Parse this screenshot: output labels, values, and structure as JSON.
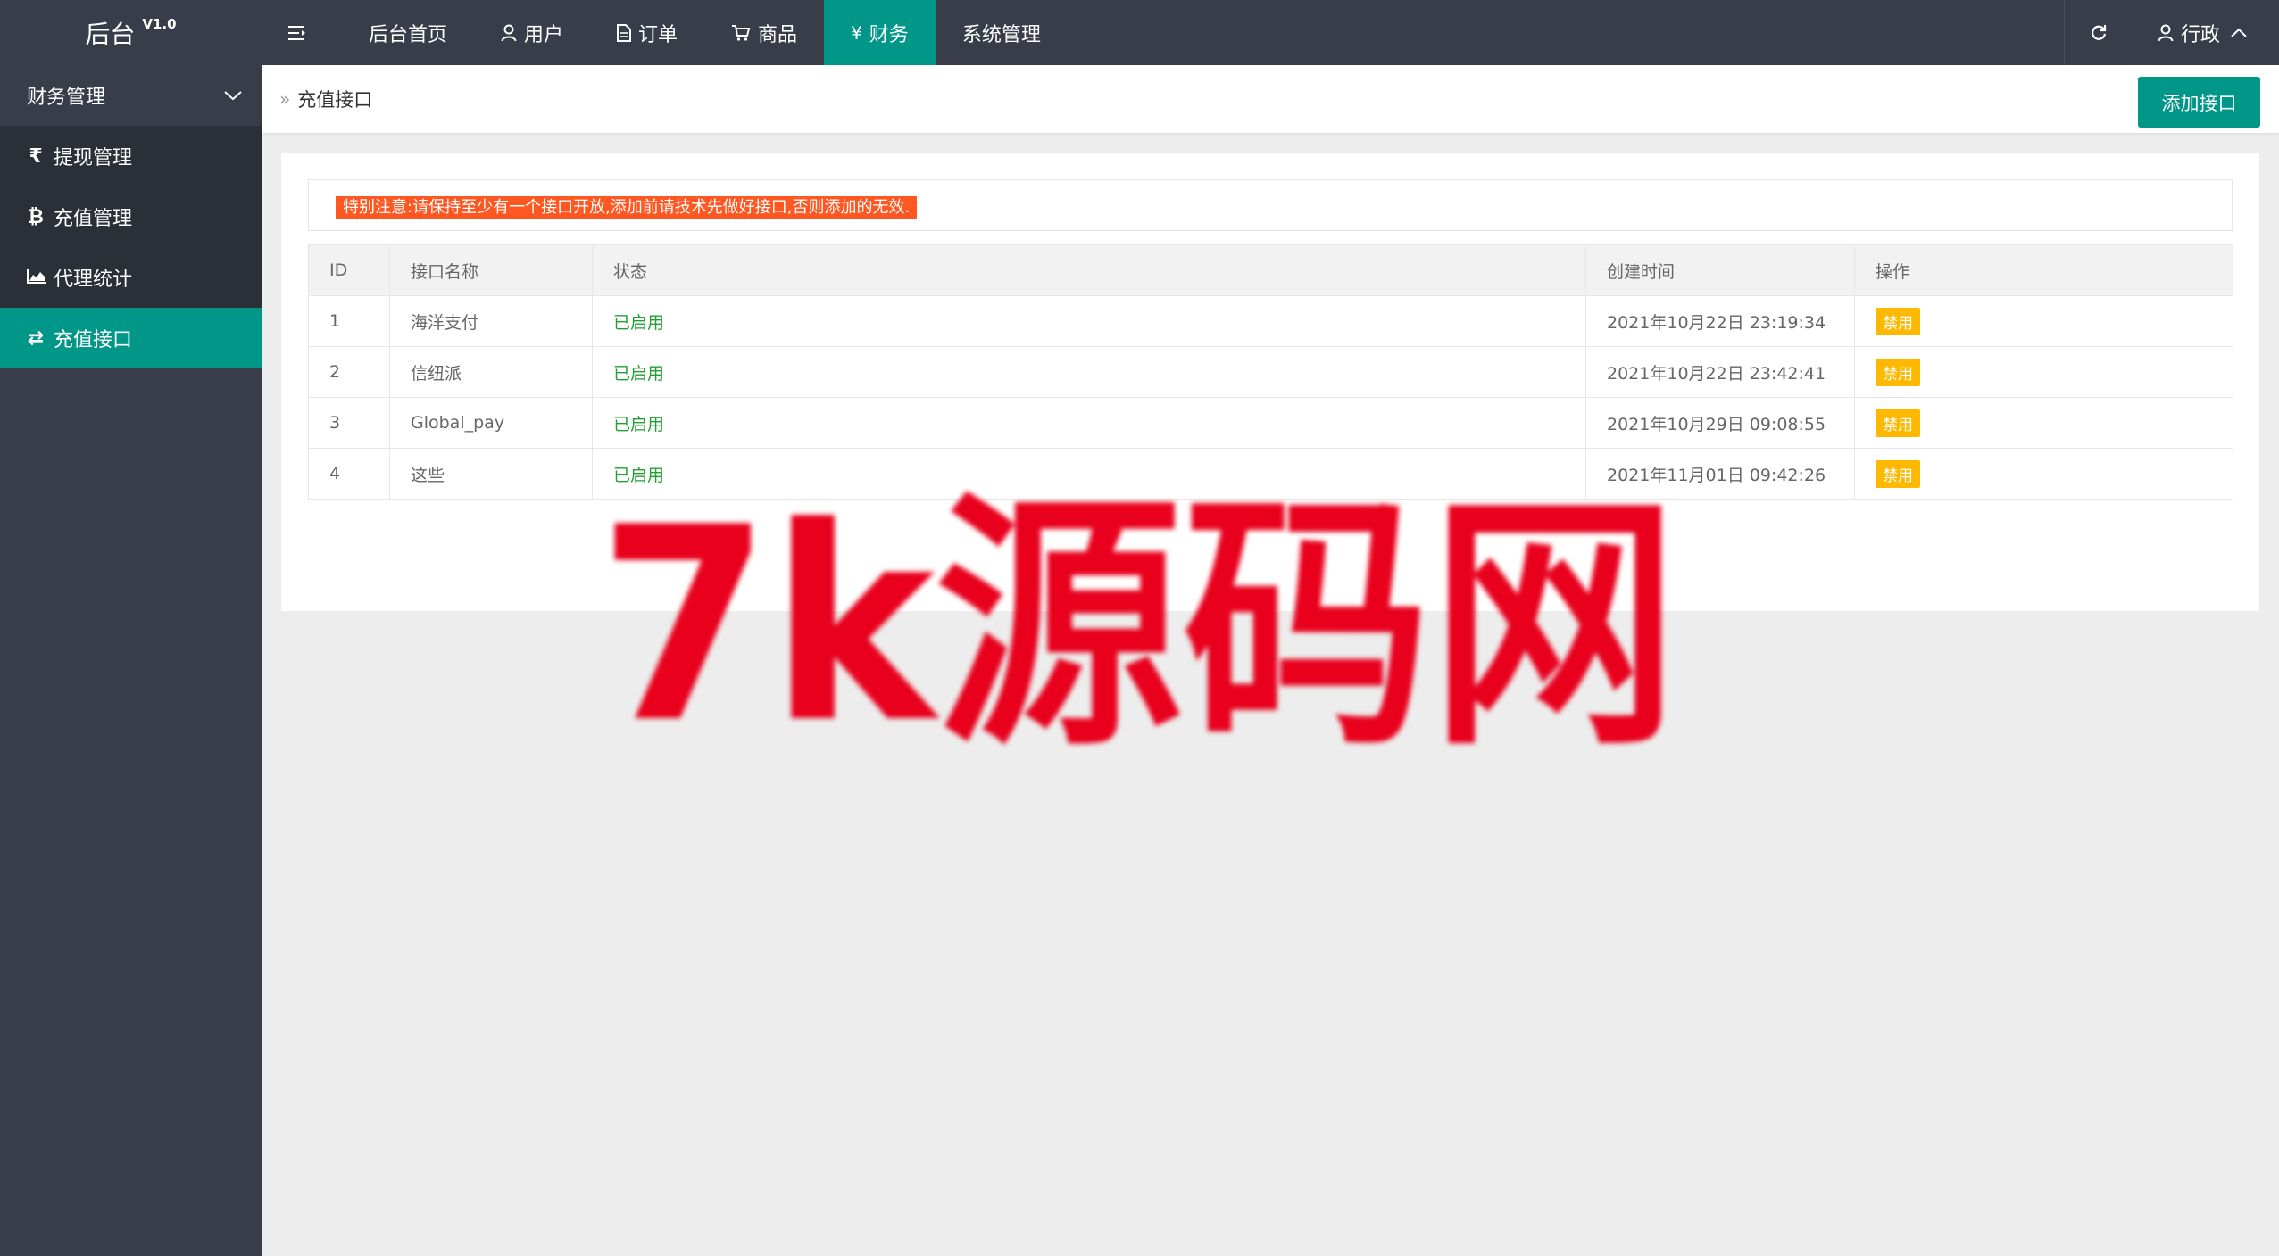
{
  "header": {
    "logo_title": "后台",
    "logo_version": "V1.0",
    "nav": [
      {
        "label": "后台首页",
        "icon": "none"
      },
      {
        "label": "用户",
        "icon": "user-icon"
      },
      {
        "label": "订单",
        "icon": "file-icon"
      },
      {
        "label": "商品",
        "icon": "cart-icon"
      },
      {
        "label": "财务",
        "icon": "yen-icon",
        "active": true
      },
      {
        "label": "系统管理",
        "icon": "none"
      }
    ],
    "user_label": "行政"
  },
  "sidebar": {
    "group_label": "财务管理",
    "items": [
      {
        "label": "提现管理",
        "icon": "rupee-icon"
      },
      {
        "label": "充值管理",
        "icon": "bitcoin-icon"
      },
      {
        "label": "代理统计",
        "icon": "area-chart-icon"
      },
      {
        "label": "充值接口",
        "icon": "exchange-icon",
        "active": true
      }
    ]
  },
  "breadcrumb": {
    "current": "充值接口"
  },
  "toolbar": {
    "add_label": "添加接口"
  },
  "notice": "特别注意:请保持至少有一个接口开放,添加前请技术先做好接口,否则添加的无效.",
  "table": {
    "columns": [
      "ID",
      "接口名称",
      "状态",
      "创建时间",
      "操作"
    ],
    "rows": [
      {
        "id": "1",
        "name": "海洋支付",
        "status": "已启用",
        "created": "2021年10月22日 23:19:34",
        "action": "禁用"
      },
      {
        "id": "2",
        "name": "信纽派",
        "status": "已启用",
        "created": "2021年10月22日 23:42:41",
        "action": "禁用"
      },
      {
        "id": "3",
        "name": "Global_pay",
        "status": "已启用",
        "created": "2021年10月29日 09:08:55",
        "action": "禁用"
      },
      {
        "id": "4",
        "name": "这些",
        "status": "已启用",
        "created": "2021年11月01日 09:42:26",
        "action": "禁用"
      }
    ]
  },
  "watermark": {
    "text": "7k源码网",
    "color": "#e8001c"
  },
  "colors": {
    "accent": "#009688",
    "dark": "#393d49",
    "warning": "#ffb800",
    "danger": "#ff5722",
    "success": "#22a033"
  }
}
